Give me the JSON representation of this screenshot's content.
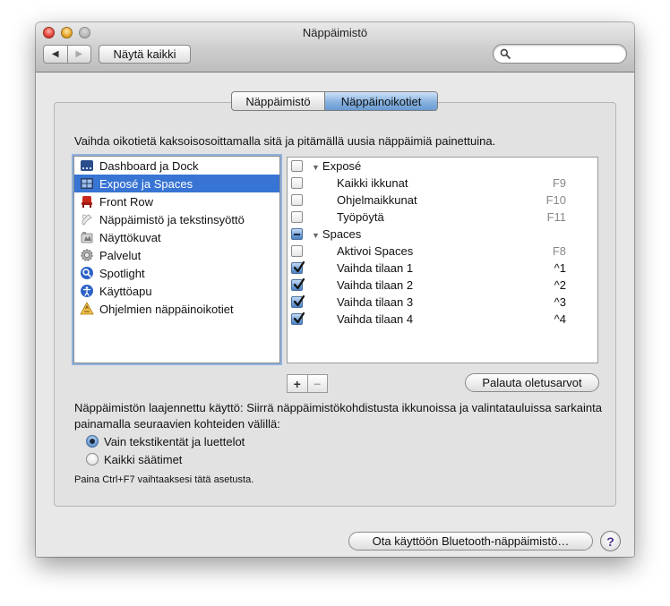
{
  "window": {
    "title": "Näppäimistö"
  },
  "toolbar": {
    "back_glyph": "◀",
    "forward_glyph": "▶",
    "show_all_label": "Näytä kaikki",
    "search_value": "",
    "search_icon": "magnifier-icon"
  },
  "tabs": [
    {
      "label": "Näppäimistö",
      "selected": false
    },
    {
      "label": "Näppäinoikotiet",
      "selected": true
    }
  ],
  "instruction": "Vaihda oikotietä kaksoisosoittamalla sitä ja pitämällä uusia näppäimiä painettuina.",
  "categories": [
    {
      "label": "Dashboard ja Dock",
      "icon": "dashboard-dock-icon",
      "selected": false
    },
    {
      "label": "Exposé ja Spaces",
      "icon": "expose-spaces-icon",
      "selected": true
    },
    {
      "label": "Front Row",
      "icon": "front-row-icon",
      "selected": false
    },
    {
      "label": "Näppäimistö ja tekstinsyöttö",
      "icon": "keyboard-text-input-icon",
      "selected": false
    },
    {
      "label": "Näyttökuvat",
      "icon": "screenshots-icon",
      "selected": false
    },
    {
      "label": "Palvelut",
      "icon": "services-gear-icon",
      "selected": false
    },
    {
      "label": "Spotlight",
      "icon": "spotlight-icon",
      "selected": false
    },
    {
      "label": "Käyttöapu",
      "icon": "universal-access-icon",
      "selected": false
    },
    {
      "label": "Ohjelmien näppäinoikotiet",
      "icon": "app-shortcuts-icon",
      "selected": false
    }
  ],
  "shortcuts": [
    {
      "type": "group",
      "label": "Exposé",
      "state": "unchecked"
    },
    {
      "type": "item",
      "label": "Kaikki ikkunat",
      "key": "F9",
      "state": "unchecked"
    },
    {
      "type": "item",
      "label": "Ohjelmaikkunat",
      "key": "F10",
      "state": "unchecked"
    },
    {
      "type": "item",
      "label": "Työpöytä",
      "key": "F11",
      "state": "unchecked"
    },
    {
      "type": "group",
      "label": "Spaces",
      "state": "mixed"
    },
    {
      "type": "item",
      "label": "Aktivoi Spaces",
      "key": "F8",
      "state": "unchecked"
    },
    {
      "type": "item",
      "label": "Vaihda tilaan 1",
      "key": "^1",
      "state": "checked"
    },
    {
      "type": "item",
      "label": "Vaihda tilaan 2",
      "key": "^2",
      "state": "checked"
    },
    {
      "type": "item",
      "label": "Vaihda tilaan 3",
      "key": "^3",
      "state": "checked"
    },
    {
      "type": "item",
      "label": "Vaihda tilaan 4",
      "key": "^4",
      "state": "checked"
    }
  ],
  "list_controls": {
    "add_label": "+",
    "remove_label": "−"
  },
  "restore_label": "Palauta oletusarvot",
  "keyboard_access": {
    "description": "Näppäimistön laajennettu käyttö: Siirrä näppäimistökohdistusta ikkunoissa ja valintatauluissa sarkainta painamalla seuraavien kohteiden välillä:",
    "options": [
      {
        "label": "Vain tekstikentät ja luettelot",
        "selected": true
      },
      {
        "label": "Kaikki säätimet",
        "selected": false
      }
    ],
    "hint": "Paina Ctrl+F7 vaihtaaksesi tätä asetusta."
  },
  "bluetooth_button_label": "Ota käyttöön Bluetooth-näppäimistö…",
  "help_label": "?",
  "colors": {
    "selection": "#3874d3",
    "window_bg": "#e8e8e8",
    "tab_selected": "#87b2e0"
  }
}
